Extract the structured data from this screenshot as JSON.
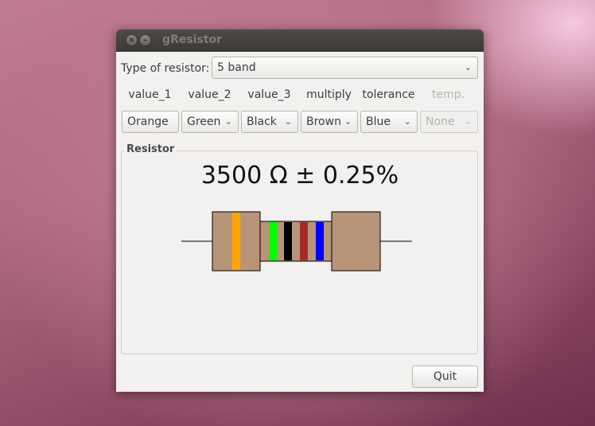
{
  "window": {
    "title": "gResistor"
  },
  "type_row": {
    "label": "Type of resistor:",
    "selected": "5 band"
  },
  "columns": [
    {
      "header": "value_1",
      "selected": "Orange",
      "enabled": true
    },
    {
      "header": "value_2",
      "selected": "Green",
      "enabled": true
    },
    {
      "header": "value_3",
      "selected": "Black",
      "enabled": true
    },
    {
      "header": "multiply",
      "selected": "Brown",
      "enabled": true
    },
    {
      "header": "tolerance",
      "selected": "Blue",
      "enabled": true
    },
    {
      "header": "temp.",
      "selected": "None",
      "enabled": false
    }
  ],
  "frame": {
    "title": "Resistor"
  },
  "result": {
    "text": "3500 Ω ± 0.25%"
  },
  "bands": {
    "band1": "#ffa500",
    "band2": "#00ff00",
    "band3": "#000000",
    "band4": "#a52a2a",
    "band5": "#0000ff"
  },
  "body_color": "#b89479",
  "quit_label": "Quit"
}
